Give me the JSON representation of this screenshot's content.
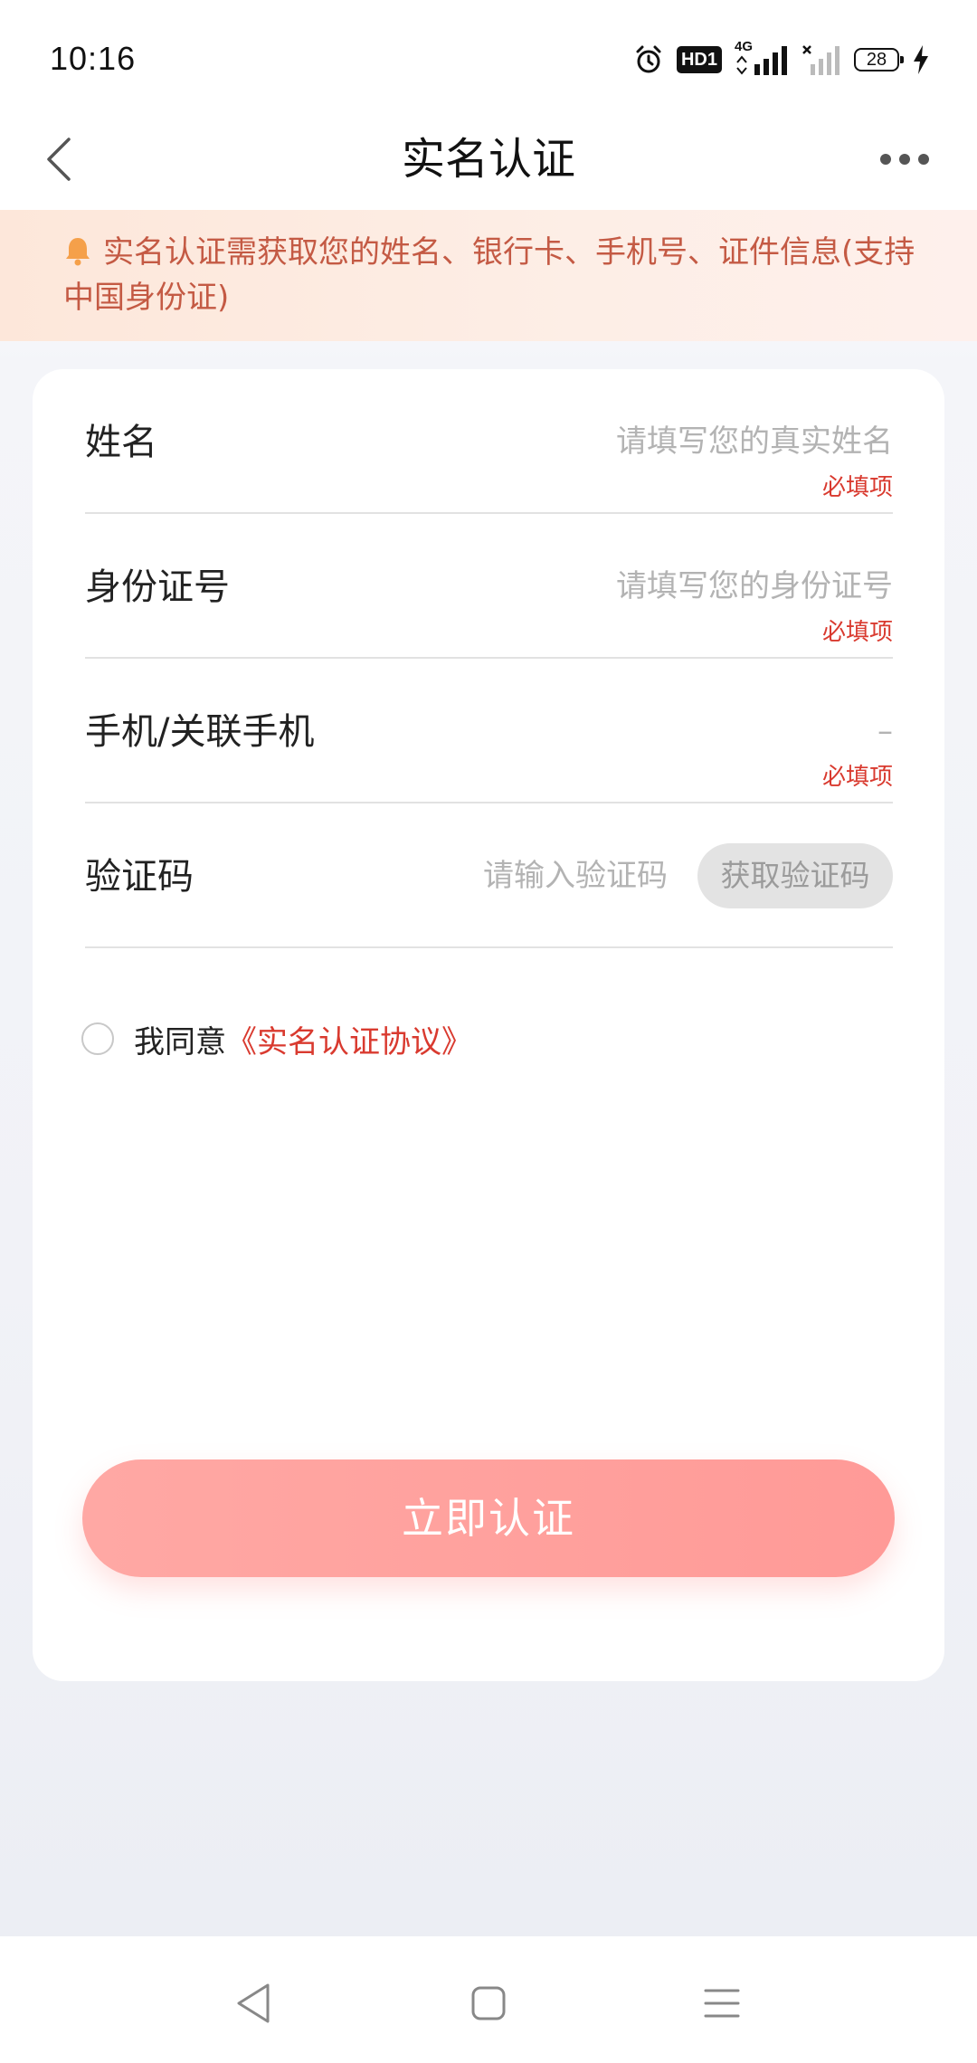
{
  "status_bar": {
    "time": "10:16",
    "hd_label": "HD1",
    "network_label": "4G",
    "battery_level": "28",
    "icons": [
      "alarm-icon",
      "hd-icon",
      "signal-4g-icon",
      "signal-no-sim-icon",
      "battery-icon",
      "charging-icon"
    ]
  },
  "header": {
    "title": "实名认证",
    "back_icon": "chevron-left-icon",
    "more_icon": "more-horizontal-icon"
  },
  "notice": {
    "icon": "bell-icon",
    "text": "实名认证需获取您的姓名、银行卡、手机号、证件信息(支持中国身份证)"
  },
  "form": {
    "name": {
      "label": "姓名",
      "placeholder": "请填写您的真实姓名",
      "required": "必填项"
    },
    "id_number": {
      "label": "身份证号",
      "placeholder": "请填写您的身份证号",
      "required": "必填项"
    },
    "phone": {
      "label": "手机/关联手机",
      "value": "–",
      "required": "必填项"
    },
    "code": {
      "label": "验证码",
      "placeholder": "请输入验证码",
      "button": "获取验证码"
    }
  },
  "agreement": {
    "prefix": "我同意",
    "link": "《实名认证协议》",
    "checked": false
  },
  "submit": {
    "label": "立即认证"
  },
  "colors": {
    "accent_red": "#d93a2f",
    "notice_text": "#c45a44",
    "notice_bg": "#fde7da",
    "submit_bg": "#ffa8a4"
  },
  "system_nav": {
    "icons": [
      "back-triangle-icon",
      "home-square-icon",
      "menu-lines-icon"
    ]
  }
}
